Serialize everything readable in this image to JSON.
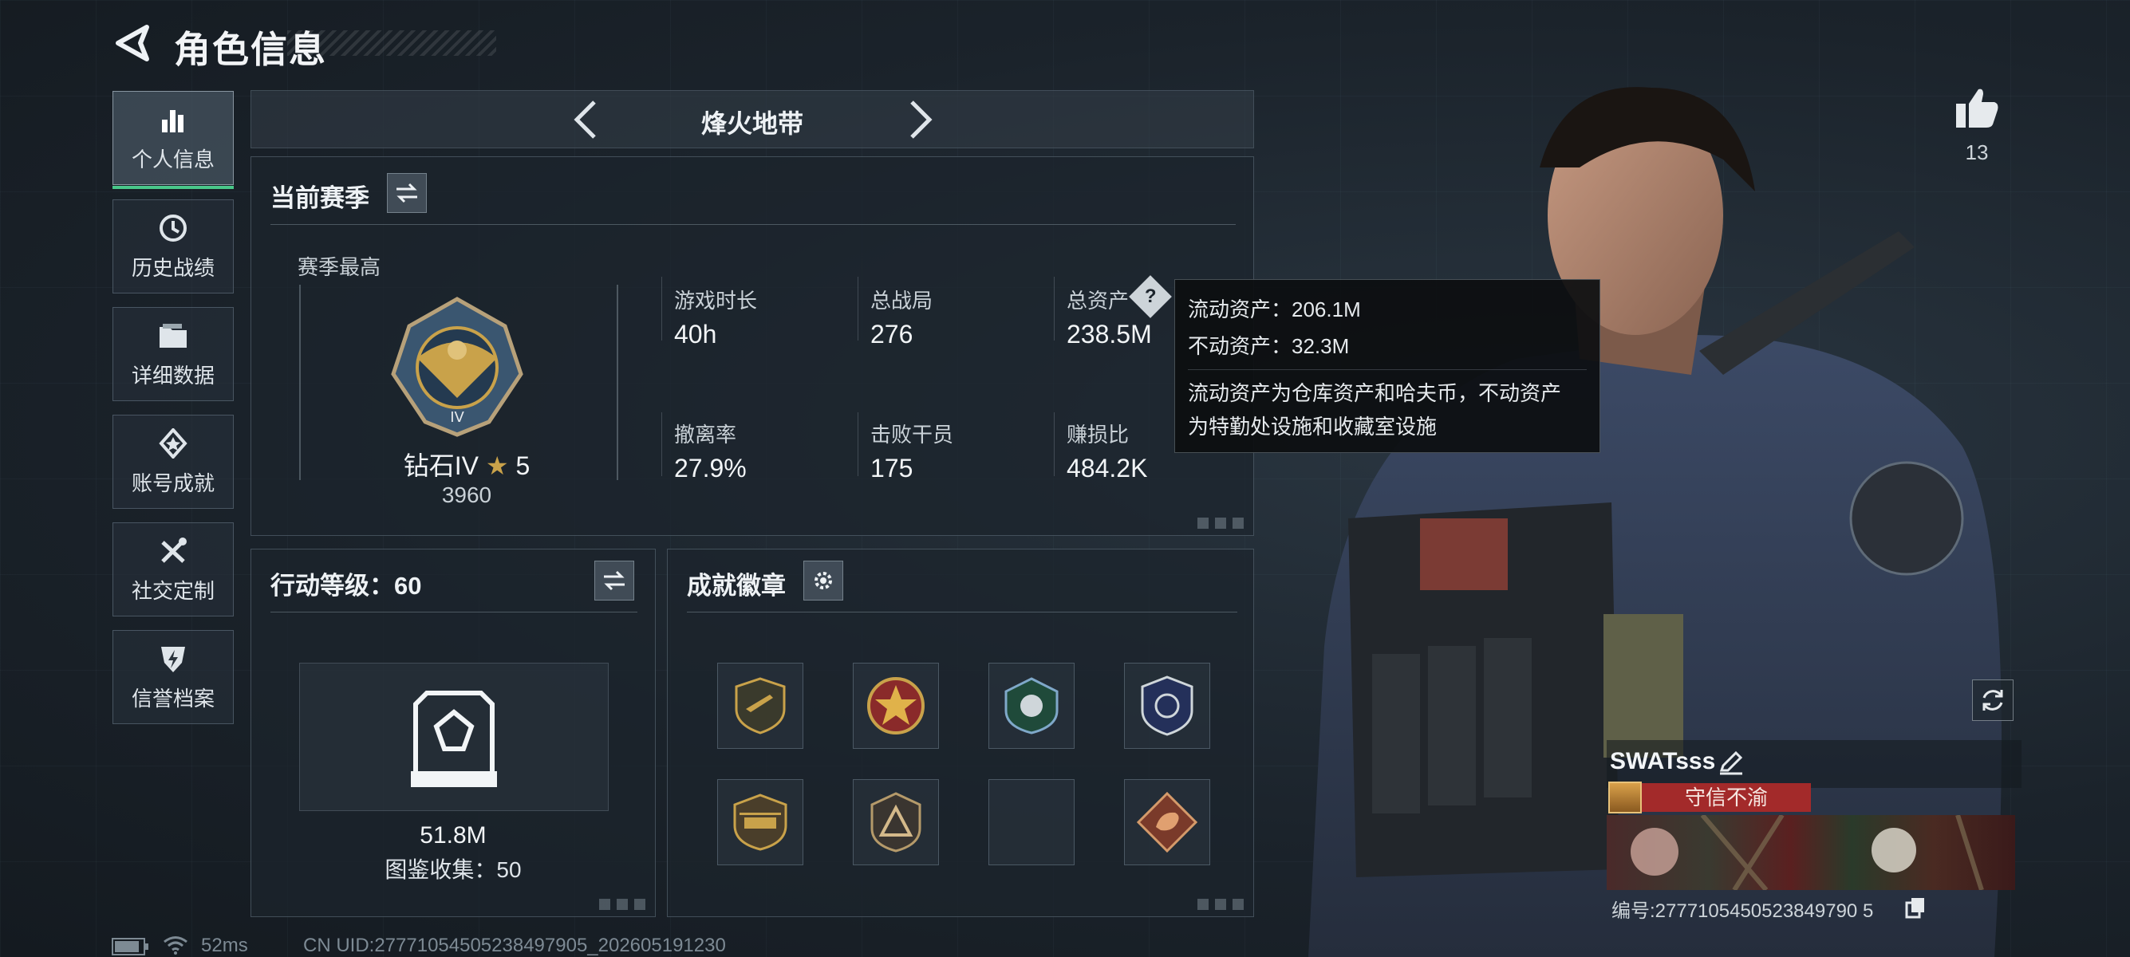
{
  "header": {
    "title": "角色信息"
  },
  "sidebar": {
    "items": [
      {
        "label": "个人信息",
        "icon": "bar-chart-icon",
        "active": true
      },
      {
        "label": "历史战绩",
        "icon": "history-icon"
      },
      {
        "label": "详细数据",
        "icon": "folder-icon"
      },
      {
        "label": "账号成就",
        "icon": "achievement-icon"
      },
      {
        "label": "社交定制",
        "icon": "tools-icon"
      },
      {
        "label": "信誉档案",
        "icon": "shield-bolt-icon"
      }
    ]
  },
  "mode": {
    "title": "烽火地带"
  },
  "season": {
    "title": "当前赛季",
    "best_label": "赛季最高",
    "rank_name": "钻石IV",
    "rank_stars": "5",
    "rank_score": "3960",
    "stats": [
      {
        "label": "游戏时长",
        "value": "40h"
      },
      {
        "label": "总战局",
        "value": "276"
      },
      {
        "label": "总资产",
        "value": "238.5M"
      },
      {
        "label": "撤离率",
        "value": "27.9%"
      },
      {
        "label": "击败干员",
        "value": "175"
      },
      {
        "label": "赚损比",
        "value": "484.2K"
      }
    ]
  },
  "tooltip": {
    "line1": "流动资产：206.1M",
    "line2": "不动资产：32.3M",
    "desc1": "流动资产为仓库资产和哈夫币，不动资产",
    "desc2": "为特勤处设施和收藏室设施"
  },
  "action_level": {
    "title": "行动等级：60",
    "collection_value": "51.8M",
    "collection_label": "图鉴收集：50"
  },
  "badges": {
    "title": "成就徽章"
  },
  "profile": {
    "likes": "13",
    "player_name": "SWATsss",
    "title_badge": "守信不渝",
    "player_id": "编号:2777105450523849790 5"
  },
  "status": {
    "ping": "52ms",
    "uid": "CN UID:27771054505238497905_202605191230"
  },
  "colors": {
    "accent_green": "#49c78a",
    "title_red": "#a32a2a",
    "gold": "#c9a24a"
  }
}
